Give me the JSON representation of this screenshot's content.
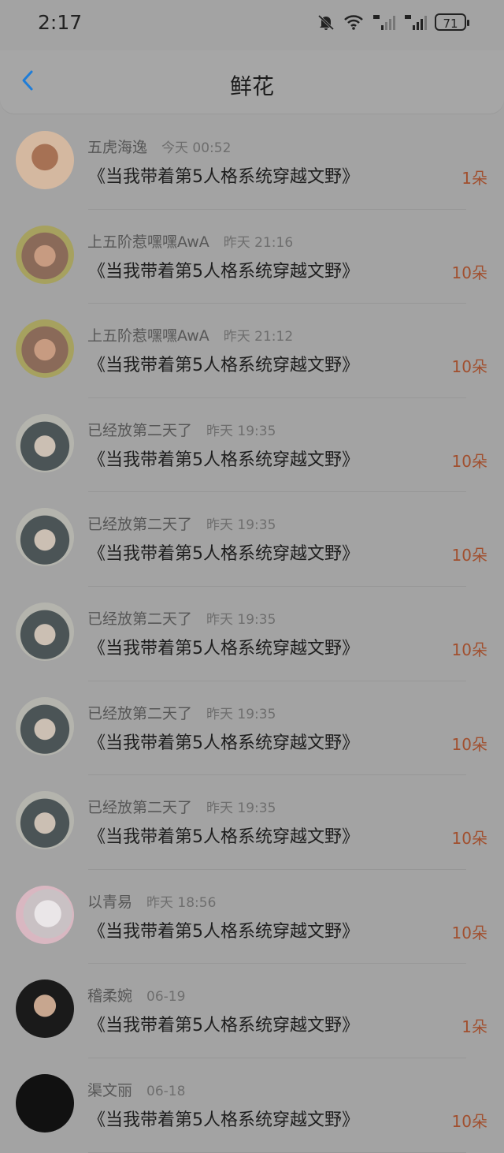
{
  "status": {
    "time": "2:17",
    "battery": "71"
  },
  "header": {
    "title": "鲜花"
  },
  "items": [
    {
      "name": "五虎海逸",
      "time": "今天 00:52",
      "book": "《当我带着第5人格系统穿越文野》",
      "amount": "1朵"
    },
    {
      "name": "上五阶惹嘿嘿AwA",
      "time": "昨天 21:16",
      "book": "《当我带着第5人格系统穿越文野》",
      "amount": "10朵"
    },
    {
      "name": "上五阶惹嘿嘿AwA",
      "time": "昨天 21:12",
      "book": "《当我带着第5人格系统穿越文野》",
      "amount": "10朵"
    },
    {
      "name": "已经放第二天了",
      "time": "昨天 19:35",
      "book": "《当我带着第5人格系统穿越文野》",
      "amount": "10朵"
    },
    {
      "name": "已经放第二天了",
      "time": "昨天 19:35",
      "book": "《当我带着第5人格系统穿越文野》",
      "amount": "10朵"
    },
    {
      "name": "已经放第二天了",
      "time": "昨天 19:35",
      "book": "《当我带着第5人格系统穿越文野》",
      "amount": "10朵"
    },
    {
      "name": "已经放第二天了",
      "time": "昨天 19:35",
      "book": "《当我带着第5人格系统穿越文野》",
      "amount": "10朵"
    },
    {
      "name": "已经放第二天了",
      "time": "昨天 19:35",
      "book": "《当我带着第5人格系统穿越文野》",
      "amount": "10朵"
    },
    {
      "name": "以青易",
      "time": "昨天 18:56",
      "book": "《当我带着第5人格系统穿越文野》",
      "amount": "10朵"
    },
    {
      "name": "稽柔婉",
      "time": "06-19",
      "book": "《当我带着第5人格系统穿越文野》",
      "amount": "1朵"
    },
    {
      "name": "渠文丽",
      "time": "06-18",
      "book": "《当我带着第5人格系统穿越文野》",
      "amount": "10朵"
    }
  ]
}
